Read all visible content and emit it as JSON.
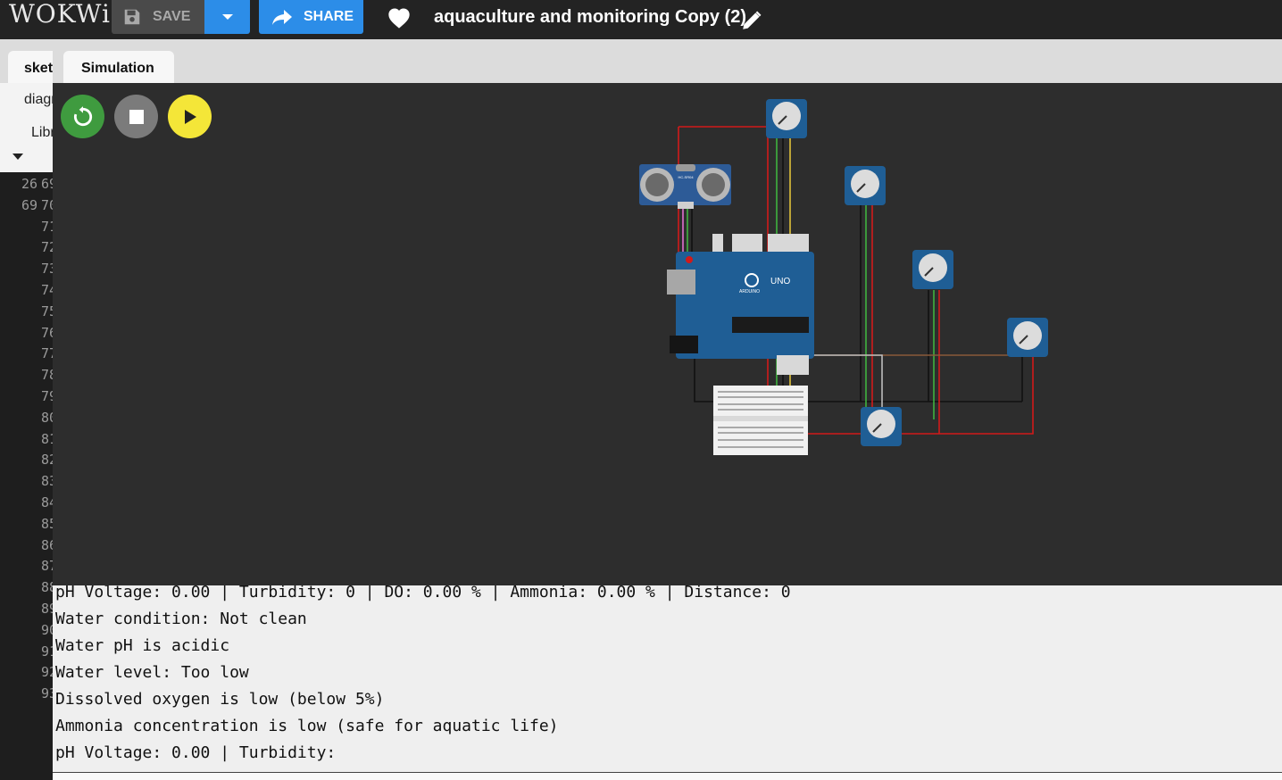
{
  "header": {
    "logo": "WOKWi",
    "save_label": "SAVE",
    "share_label": "SHARE",
    "project_title": "aquaculture and monitoring Copy (2)"
  },
  "tabs": {
    "sketch_label": "sketch.ino",
    "simulation_label": "Simulation"
  },
  "left_panel": {
    "subtabs": [
      "diagram.json",
      "Library Manager"
    ],
    "gutter": [
      {
        "a": "26",
        "b": "69"
      },
      {
        "a": "69",
        "b": "70"
      },
      {
        "a": "",
        "b": "71"
      },
      {
        "a": "",
        "b": "72"
      },
      {
        "a": "",
        "b": "73"
      },
      {
        "a": "",
        "b": "74"
      },
      {
        "a": "",
        "b": "75"
      },
      {
        "a": "",
        "b": "76"
      },
      {
        "a": "",
        "b": "77"
      },
      {
        "a": "",
        "b": "78"
      },
      {
        "a": "",
        "b": "79"
      },
      {
        "a": "",
        "b": "80"
      },
      {
        "a": "",
        "b": "81"
      },
      {
        "a": "",
        "b": "82"
      },
      {
        "a": "",
        "b": "83"
      },
      {
        "a": "",
        "b": "84"
      },
      {
        "a": "",
        "b": "85"
      },
      {
        "a": "",
        "b": "86"
      },
      {
        "a": "",
        "b": "87"
      },
      {
        "a": "",
        "b": "88"
      },
      {
        "a": "",
        "b": "89"
      },
      {
        "a": "",
        "b": "90"
      },
      {
        "a": "",
        "b": "91"
      },
      {
        "a": "",
        "b": "92"
      },
      {
        "a": "",
        "b": "93"
      }
    ]
  },
  "simulation": {
    "board_label": "UNO",
    "board_brand": "ARDUINO",
    "sensor_label": "HC-SR04"
  },
  "serial_monitor": {
    "lines": [
      "pH Voltage: 0.00 | Turbidity: 0 | DO: 0.00 % | Ammonia: 0.00 % | Distance: 0",
      "Water condition: Not clean",
      "Water pH is acidic",
      "Water level: Too low",
      "Dissolved oxygen is low (below 5%)",
      "Ammonia concentration is low (safe for aquatic life)",
      "pH Voltage: 0.00 | Turbidity:"
    ]
  },
  "colors": {
    "header_bg": "#232323",
    "accent_blue": "#2c8de8",
    "restart_green": "#3f9b3f",
    "stop_gray": "#7b7b7b",
    "play_yellow": "#f4e638",
    "board_blue": "#1f5e95",
    "wire_red": "#d11a1a"
  }
}
